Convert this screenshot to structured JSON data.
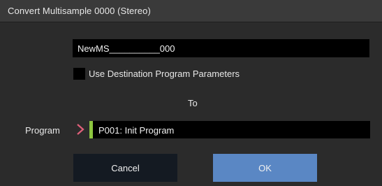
{
  "dialog": {
    "title": "Convert Multisample 0000 (Stereo)"
  },
  "name_field": {
    "value": "NewMS__________000"
  },
  "option": {
    "label": "Use Destination Program Parameters",
    "checked": false
  },
  "to_label": "To",
  "program": {
    "label": "Program",
    "value": "P001: Init Program",
    "accent_color": "#8dc63f",
    "chevron_color": "#e0607a"
  },
  "buttons": {
    "cancel": "Cancel",
    "ok": "OK",
    "ok_color": "#5a87c4"
  }
}
